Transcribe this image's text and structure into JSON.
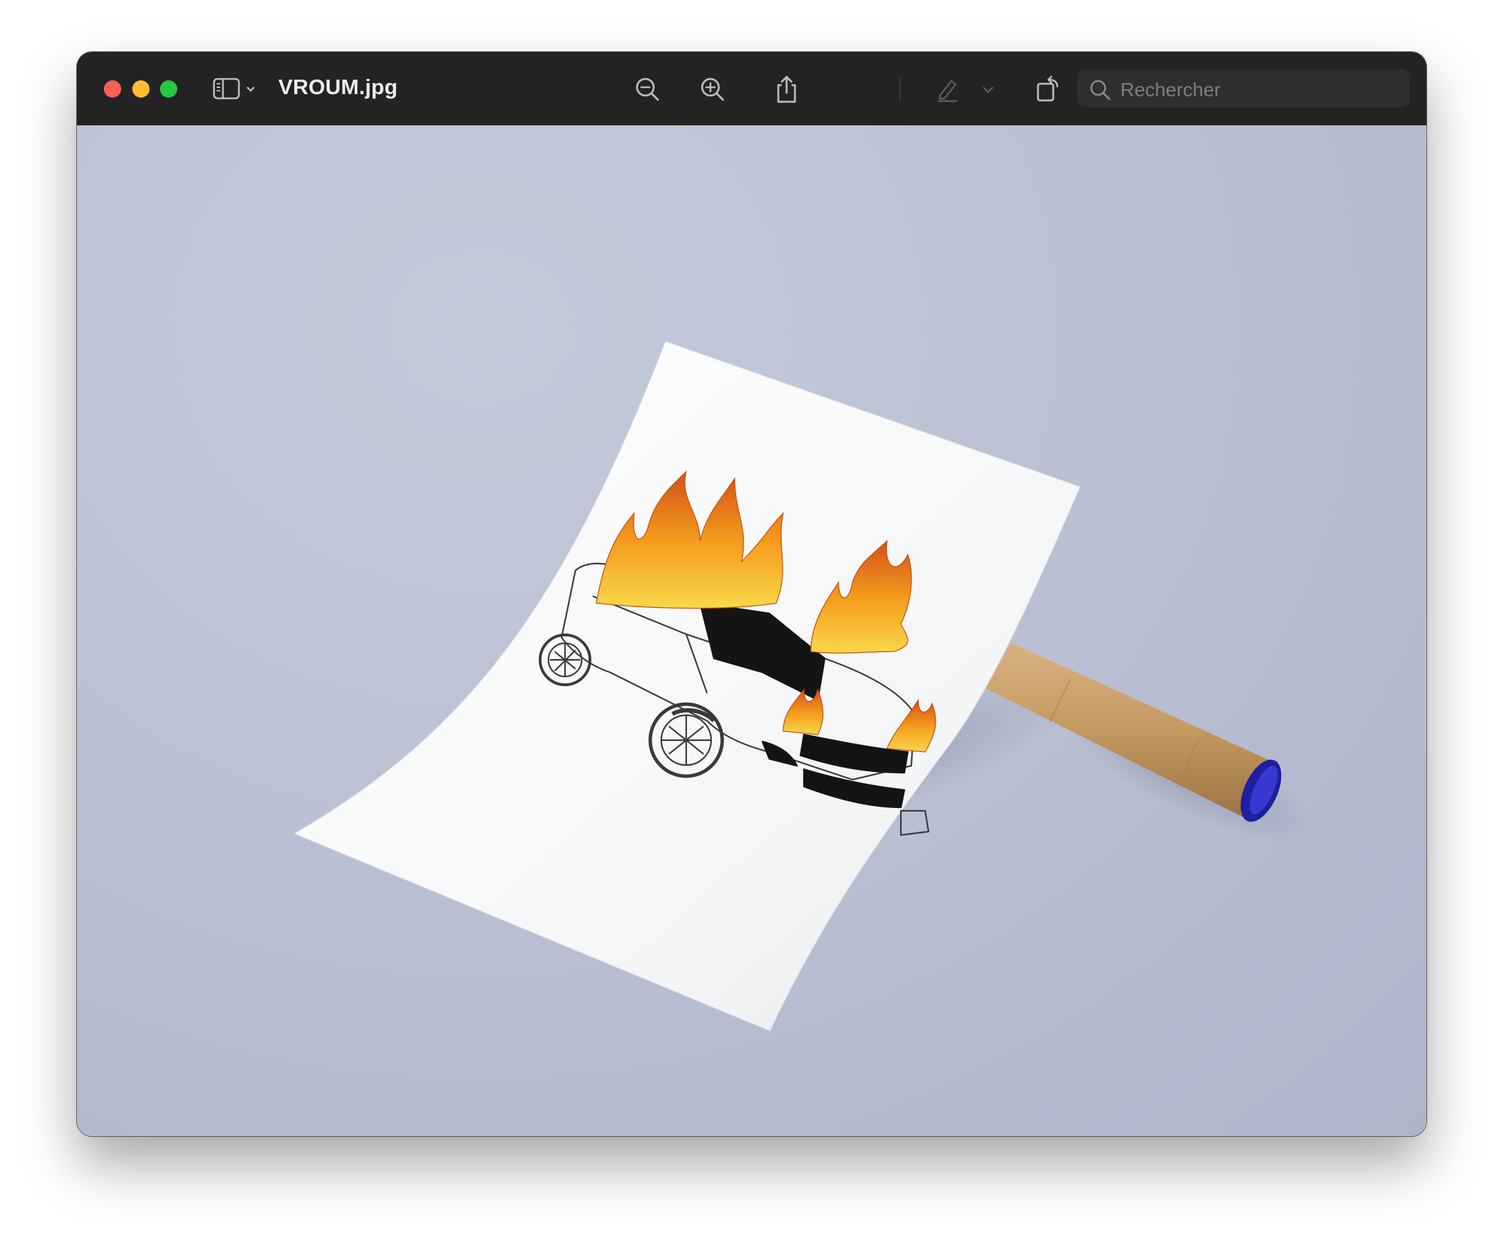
{
  "window": {
    "title": "VROUM.jpg"
  },
  "toolbar": {
    "sidebar_toggle": "sidebar-icon",
    "zoom_out": "zoom-out-icon",
    "zoom_in": "zoom-in-icon",
    "share": "share-icon",
    "markup_pen": "pen-icon",
    "rotate": "rotate-icon",
    "annotate": "markup-icon"
  },
  "search": {
    "placeholder": "Rechercher"
  },
  "colors": {
    "titlebar": "#232323",
    "close": "#fe5f57",
    "minimize": "#febc2e",
    "maximize": "#28c840",
    "backdrop": "#b9c1d3",
    "tube": "#c59a63",
    "cap": "#2a2aa8",
    "flame": "#f39a1c"
  }
}
